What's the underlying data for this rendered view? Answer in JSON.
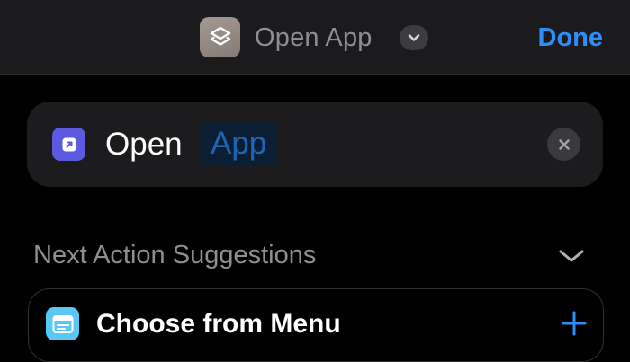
{
  "navbar": {
    "app_icon": "shortcuts-layers-icon",
    "title": "Open App",
    "title_menu_icon": "chevron-down-icon",
    "done_label": "Done"
  },
  "action": {
    "icon": "open-arrow-icon",
    "verb": "Open",
    "parameter_placeholder": "App",
    "clear_icon": "x-mark-circle-icon"
  },
  "suggestions": {
    "header": "Next Action Suggestions",
    "collapse_icon": "chevron-down-icon",
    "items": [
      {
        "label": "Choose from Menu",
        "icon": "menu-list-icon",
        "add_icon": "plus-icon"
      }
    ]
  },
  "colors": {
    "accent": "#2e8ef7",
    "navbar_bg": "#1b1b1d",
    "card_bg": "#1c1c1e",
    "open_icon_bg": "#5b5ae0",
    "menu_icon_bg": "#5ac8f5",
    "app_icon_bg": "#968c85",
    "param_token_bg": "#0c1e33"
  }
}
